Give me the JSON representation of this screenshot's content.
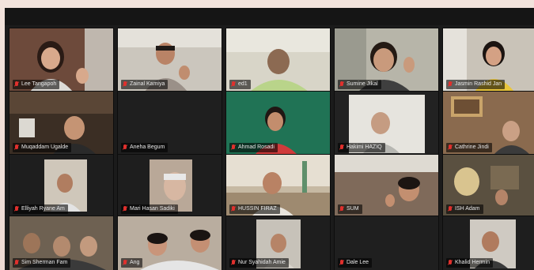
{
  "meeting": {
    "participants": [
      {
        "name": "Lee Tangapoh",
        "muted": true
      },
      {
        "name": "Zainal Kamiya",
        "muted": true
      },
      {
        "name": "ed1",
        "muted": true
      },
      {
        "name": "Sumine Jikal",
        "muted": true
      },
      {
        "name": "Jasmin Rashid Jan",
        "muted": true
      },
      {
        "name": "Muqaddam Ugalde",
        "muted": true
      },
      {
        "name": "Aneha Begum",
        "muted": true
      },
      {
        "name": "Ahmad Rosadi",
        "muted": true
      },
      {
        "name": "Hakimi HAZIQ",
        "muted": true
      },
      {
        "name": "Cathrine Jindi",
        "muted": true
      },
      {
        "name": "Elliyah Ryane Am",
        "muted": true
      },
      {
        "name": "Mari Hasan Sadiki",
        "muted": true
      },
      {
        "name": "HUSSIN FIRAZ",
        "muted": true
      },
      {
        "name": "SUM",
        "muted": true
      },
      {
        "name": "ISH Adam",
        "muted": true
      },
      {
        "name": "Sim Sherman Fam",
        "muted": true
      },
      {
        "name": "Ang",
        "muted": true
      },
      {
        "name": "Nur Syahidah Amie",
        "muted": true
      },
      {
        "name": "Dale Lee",
        "muted": true
      },
      {
        "name": "Khalid Hermin",
        "muted": true
      }
    ]
  }
}
